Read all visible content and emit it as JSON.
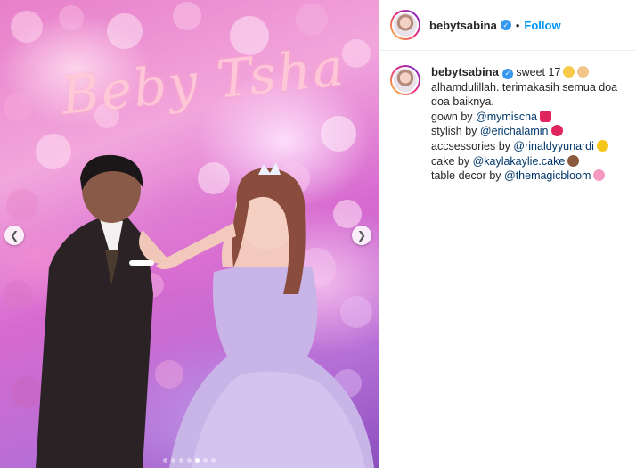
{
  "post": {
    "username": "bebytsabina",
    "follow_label": "Follow",
    "separator": "•",
    "media": {
      "sign_text": "Beby Tsha",
      "prev_icon": "chevron-left-icon",
      "next_icon": "chevron-right-icon",
      "slide_count": 7,
      "active_slide": 5
    },
    "caption": {
      "lines": [
        {
          "text": "sweet 17",
          "mention": "",
          "emoji": "smile-face, pray-hands"
        },
        {
          "text": "alhamdulillah. terimakasih semua doa doa baiknya.",
          "mention": "",
          "emoji": ""
        },
        {
          "text": "gown by ",
          "mention": "@mymischa",
          "emoji": "dress"
        },
        {
          "text": "stylish by ",
          "mention": "@erichalamin",
          "emoji": "heart"
        },
        {
          "text": "accsessories by ",
          "mention": "@rinaldyyunardi",
          "emoji": "sparkles"
        },
        {
          "text": "cake by ",
          "mention": "@kaylakaylie.cake",
          "emoji": "cake"
        },
        {
          "text": "table decor by ",
          "mention": "@themagicbloom",
          "emoji": "flower"
        }
      ]
    },
    "colors": {
      "link": "#00376b",
      "follow": "#0095f6",
      "verified": "#3897f0"
    }
  }
}
